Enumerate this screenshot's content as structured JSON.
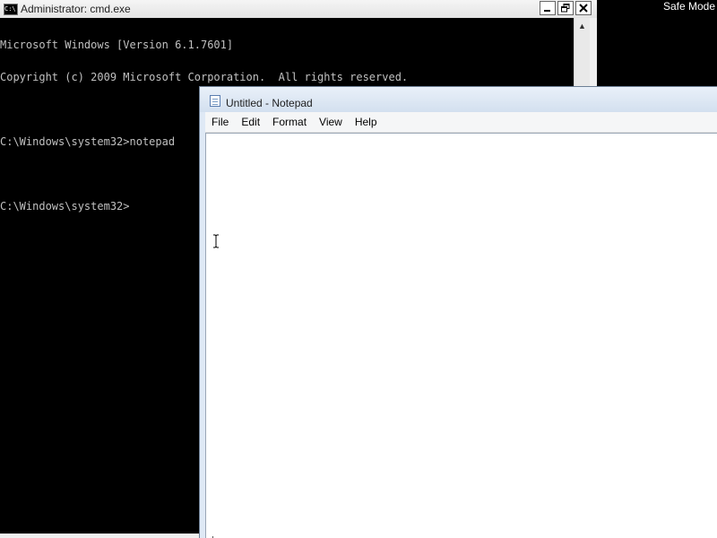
{
  "desktop": {
    "safe_mode_label": "Safe Mode"
  },
  "cmd": {
    "title": "Administrator: cmd.exe",
    "icon": "cmd-app-icon",
    "icon_text": "C:\\",
    "buttons": {
      "minimize": "minimize-icon",
      "restore": "restore-icon",
      "close": "close-icon"
    },
    "lines": [
      "Microsoft Windows [Version 6.1.7601]",
      "Copyright (c) 2009 Microsoft Corporation.  All rights reserved.",
      "",
      "C:\\Windows\\system32>notepad",
      "",
      "C:\\Windows\\system32>"
    ],
    "text_color": "#c0c0c0",
    "background_color": "#000000"
  },
  "notepad": {
    "title": "Untitled - Notepad",
    "icon": "notepad-app-icon",
    "menu": [
      "File",
      "Edit",
      "Format",
      "View",
      "Help"
    ],
    "content": "",
    "cursor": "ibeam-cursor-icon"
  }
}
